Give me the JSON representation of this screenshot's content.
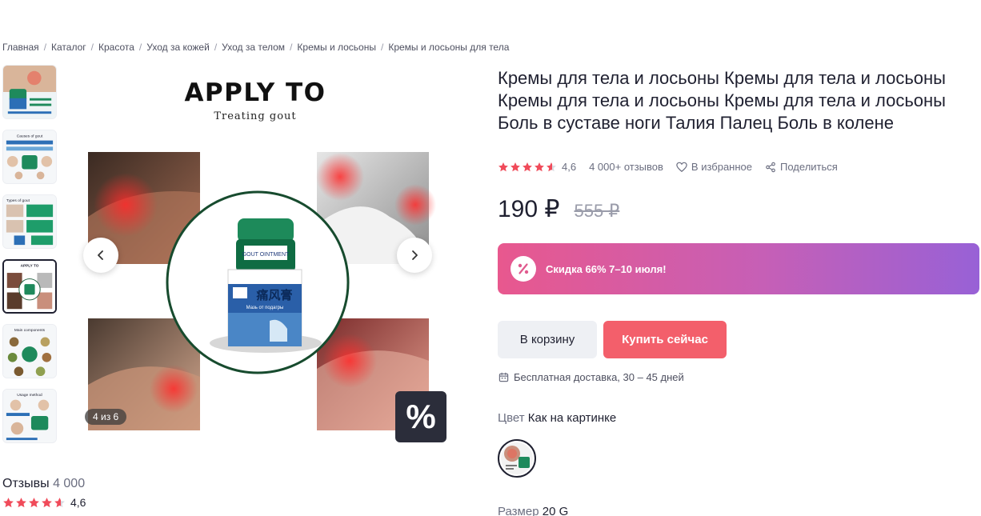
{
  "breadcrumb": [
    {
      "label": "Главная"
    },
    {
      "label": "Каталог"
    },
    {
      "label": "Красота"
    },
    {
      "label": "Уход за кожей"
    },
    {
      "label": "Уход за телом"
    },
    {
      "label": "Кремы и лосьоны"
    },
    {
      "label": "Кремы и лосьоны для тела"
    }
  ],
  "gallery": {
    "main_heading": "APPLY TO",
    "main_subheading": "Treating gout",
    "counter": "4 из 6",
    "promo_badge": "%",
    "active_thumb": 3,
    "thumb_captions": [
      "",
      "Causes of gout",
      "Types of gout",
      "APPLY TO",
      "Main components",
      "Usage method"
    ],
    "jar_label_cn": "痛风膏",
    "jar_label_ru": "Мазь от подагры",
    "jar_brand": "GOUT OINTMENT"
  },
  "reviews_block": {
    "title": "Отзывы",
    "count": "4 000",
    "rating": "4,6"
  },
  "product": {
    "title": "Кремы для тела и лосьоны Кремы для тела и лосьоны Кремы для тела и лосьоны Кремы для тела и лосьоны Боль в суставе ноги Талия Палец Боль в колене",
    "rating": "4,6",
    "rating_value": 4.6,
    "reviews_label": "4 000+ отзывов",
    "favorite_label": "В избранное",
    "share_label": "Поделиться",
    "price": "190 ₽",
    "old_price": "555 ₽",
    "sale_text": "Скидка 66% 7–10 июля!",
    "cart_button": "В корзину",
    "buy_button": "Купить сейчас",
    "delivery": "Бесплатная доставка, 30 – 45 дней",
    "color_label": "Цвет",
    "color_value": "Как на картинке",
    "size_label": "Размер",
    "size_value": "20 G"
  },
  "colors": {
    "accent_buy": "#f35f6b",
    "star": "#f04b5a",
    "banner_start": "#e8588e",
    "banner_end": "#9861d6"
  }
}
